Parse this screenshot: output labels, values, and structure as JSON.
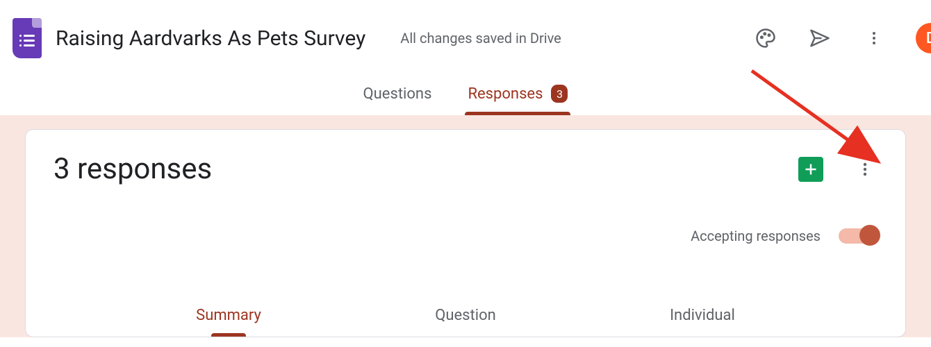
{
  "header": {
    "title": "Raising Aardvarks As Pets Survey",
    "save_status": "All changes saved in Drive",
    "avatar_initial": "D"
  },
  "main_tabs": {
    "questions": "Questions",
    "responses": "Responses",
    "responses_count": "3"
  },
  "card": {
    "title": "3 responses",
    "accepting_label": "Accepting responses"
  },
  "sub_tabs": {
    "summary": "Summary",
    "question": "Question",
    "individual": "Individual"
  }
}
